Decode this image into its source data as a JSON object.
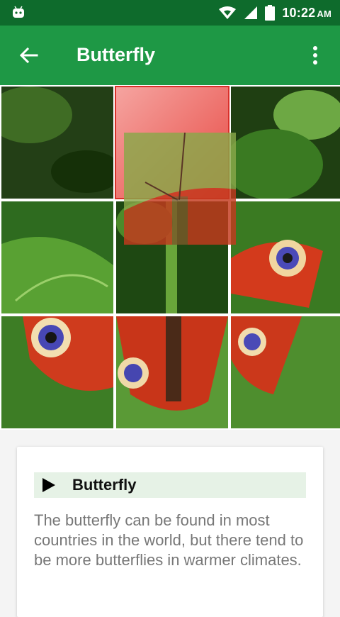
{
  "status_bar": {
    "time": "10:22",
    "ampm": "AM"
  },
  "app_bar": {
    "title": "Butterfly"
  },
  "puzzle": {
    "grid": "3x3",
    "selected_tile": 2
  },
  "card": {
    "name": "Butterfly",
    "description": "The butterfly can be found in most countries in the world, but there tend to be more butterflies in warmer climates."
  },
  "colors": {
    "status_bar": "#0e6b2c",
    "app_bar": "#1e9845",
    "selected_tile": "#e84b45",
    "card_header": "#e6f2e6"
  }
}
